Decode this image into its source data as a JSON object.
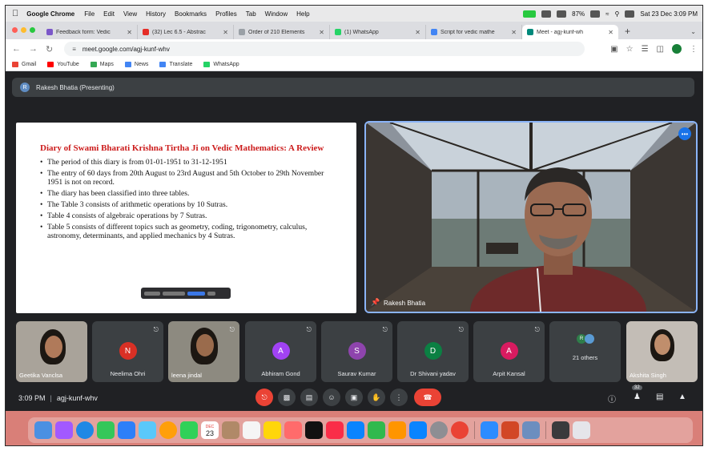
{
  "menubar": {
    "app_name": "Google Chrome",
    "items": [
      "File",
      "Edit",
      "View",
      "History",
      "Bookmarks",
      "Profiles",
      "Tab",
      "Window",
      "Help"
    ],
    "battery": "87%",
    "datetime": "Sat 23 Dec 3:09 PM"
  },
  "tabs": [
    {
      "title": "Feedback form: Vedic",
      "favicon_color": "#7b57c9"
    },
    {
      "title": "(32) Lec 6.5 - Abstrac",
      "favicon_color": "#e52d27"
    },
    {
      "title": "Order of 210 Elements",
      "favicon_color": "#9aa0a6"
    },
    {
      "title": "(1) WhatsApp",
      "favicon_color": "#25d366"
    },
    {
      "title": "Script for vedic mathe",
      "favicon_color": "#4285f4"
    },
    {
      "title": "Meet - agj-kunf-wh",
      "favicon_color": "#00897b"
    }
  ],
  "address": {
    "url": "meet.google.com/agj-kunf-whv"
  },
  "bookmarks": [
    {
      "label": "Gmail",
      "color": "#ea4335"
    },
    {
      "label": "YouTube",
      "color": "#ff0000"
    },
    {
      "label": "Maps",
      "color": "#34a853"
    },
    {
      "label": "News",
      "color": "#4285f4"
    },
    {
      "label": "Translate",
      "color": "#4285f4"
    },
    {
      "label": "WhatsApp",
      "color": "#25d366"
    }
  ],
  "presenter": {
    "avatar_letter": "R",
    "label": "Rakesh Bhatia (Presenting)"
  },
  "slide": {
    "title": "Diary of Swami Bharati Krishna Tirtha Ji on Vedic Mathematics: A Review",
    "bullets": [
      "The period of this diary is from 01-01-1951 to 31-12-1951",
      "The entry of 60 days from 20th August to 23rd August and 5th October to 29th November 1951 is not on record.",
      "The diary has been classified into three tables.",
      "The Table 3 consists of arithmetic operations by 10 Sutras.",
      "Table 4 consists of algebraic operations by 7 Sutras.",
      "Table 5 consists of different topics such as geometry, coding, trigonometry, calculus, astronomy, determinants, and applied mechanics by 4 Sutras."
    ]
  },
  "speaker": {
    "name": "Rakesh Bhatia"
  },
  "participants": [
    {
      "name": "Geetika Vanclsa",
      "type": "photo"
    },
    {
      "name": "Neelima Ohri",
      "letter": "N",
      "color": "#d93025"
    },
    {
      "name": "leena jindal",
      "type": "photo"
    },
    {
      "name": "Abhiram Gond",
      "letter": "A",
      "color": "#a142f4"
    },
    {
      "name": "Saurav Kumar",
      "letter": "S",
      "color": "#8e44ad"
    },
    {
      "name": "Dr Shivani yadav",
      "letter": "D",
      "color": "#0b8043"
    },
    {
      "name": "Arpit Kansal",
      "letter": "A",
      "color": "#d81b60"
    },
    {
      "name": "21 others",
      "type": "others"
    },
    {
      "name": "Akshita Singh",
      "type": "photo"
    }
  ],
  "controls": {
    "time": "3:09 PM",
    "separator": "|",
    "meeting_code": "agj-kunf-whv",
    "people_count": "32"
  },
  "dock": {
    "calendar_day": "23",
    "calendar_month": "DEC"
  }
}
